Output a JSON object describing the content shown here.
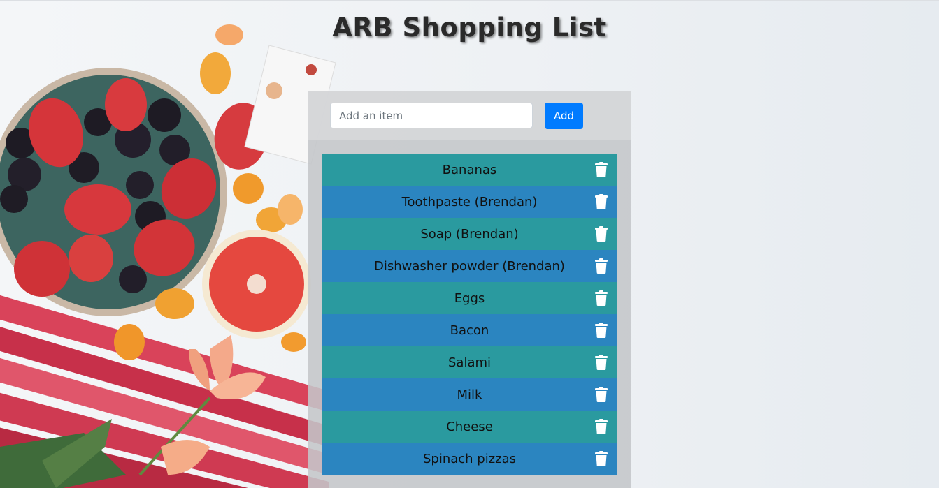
{
  "app": {
    "title": "ARB Shopping List"
  },
  "form": {
    "input_placeholder": "Add an item",
    "input_value": "",
    "add_label": "Add"
  },
  "items": [
    {
      "label": "Bananas"
    },
    {
      "label": "Toothpaste (Brendan)"
    },
    {
      "label": "Soap (Brendan)"
    },
    {
      "label": "Dishwasher powder (Brendan)"
    },
    {
      "label": "Eggs"
    },
    {
      "label": "Bacon"
    },
    {
      "label": "Salami"
    },
    {
      "label": "Milk"
    },
    {
      "label": "Cheese"
    },
    {
      "label": "Spinach pizzas"
    }
  ],
  "icons": {
    "delete": "trash-icon",
    "background": "fruit-photo"
  },
  "colors": {
    "row_odd": "#2a9a9f",
    "row_even": "#2b85c0",
    "add_button": "#007bff",
    "panel": "#c4c6c9"
  }
}
